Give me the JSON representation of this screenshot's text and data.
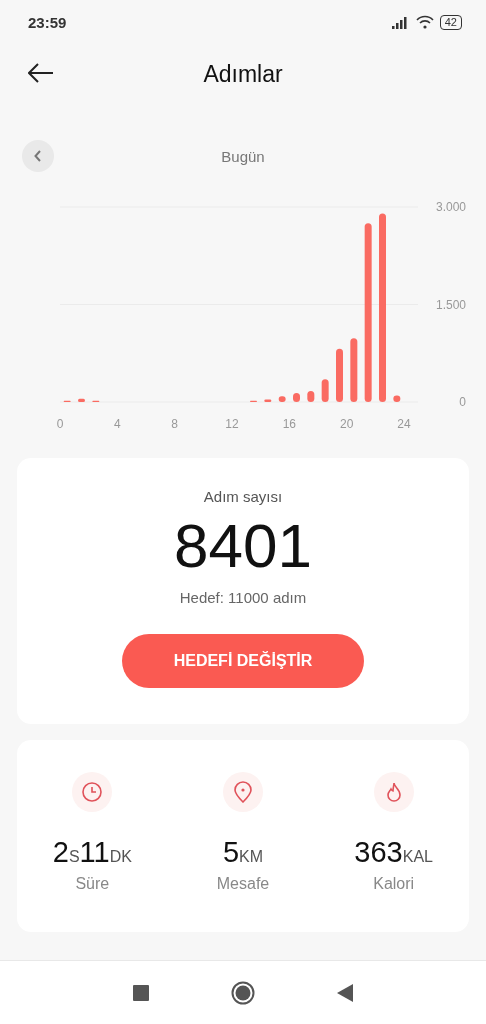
{
  "status_bar": {
    "time": "23:59",
    "battery": "42"
  },
  "header": {
    "title": "Adımlar"
  },
  "period": {
    "label": "Bugün"
  },
  "chart_data": {
    "type": "bar",
    "x": [
      0.5,
      1.5,
      2.5,
      3.5,
      4.5,
      5.5,
      6.5,
      7.5,
      8.5,
      9.5,
      10.5,
      11.5,
      12.5,
      13.5,
      14.5,
      15.5,
      16.5,
      17.5,
      18.5,
      19.5,
      20.5,
      21.5,
      22.5,
      23.5
    ],
    "series": [
      {
        "color": "#fa6b62",
        "values": [
          20,
          50,
          20,
          null,
          null,
          null,
          null,
          null,
          null,
          null,
          null,
          null,
          null,
          20,
          40,
          90,
          140,
          170,
          350,
          820,
          980,
          2750,
          2900,
          100
        ]
      }
    ],
    "xlim": [
      0,
      24
    ],
    "ylim": [
      0,
      3000
    ],
    "xticks": [
      0,
      4,
      8,
      12,
      16,
      20,
      24
    ],
    "yticks": [
      {
        "value": 0,
        "label": "0"
      },
      {
        "value": 1500,
        "label": "1.500"
      },
      {
        "value": 3000,
        "label": "3.000"
      }
    ]
  },
  "summary": {
    "label": "Adım sayısı",
    "value": "8401",
    "goal": "Hedef: 11000 adım",
    "button": "HEDEFİ DEĞİŞTİR"
  },
  "stats": [
    {
      "kind": "clock",
      "parts": [
        {
          "text": "2",
          "kind": "number"
        },
        {
          "text": "S",
          "kind": "unit"
        },
        {
          "text": "11",
          "kind": "number"
        },
        {
          "text": "DK",
          "kind": "unit"
        }
      ],
      "label": "Süre"
    },
    {
      "kind": "pin",
      "parts": [
        {
          "text": "5",
          "kind": "number"
        },
        {
          "text": "KM",
          "kind": "unit"
        }
      ],
      "label": "Mesafe"
    },
    {
      "kind": "flame",
      "parts": [
        {
          "text": "363",
          "kind": "number"
        },
        {
          "text": "KAL",
          "kind": "unit"
        }
      ],
      "label": "Kalori"
    }
  ]
}
